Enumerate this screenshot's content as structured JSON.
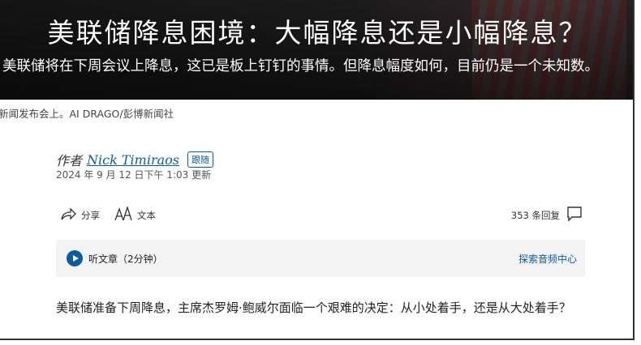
{
  "hero": {
    "title": "美联储降息困境：大幅降息还是小幅降息？",
    "subtitle": "美联储将在下周会议上降息，这已是板上钉钉的事情。但降息幅度如何，目前仍是一个未知数。"
  },
  "caption": "新闻发布会上。AI DRAGO/彭博新闻社",
  "byline": {
    "prefix": "作者",
    "author": "Nick Timiraos",
    "follow_label": "跟随",
    "date": "2024 年 9 月 12 日下午 1:03 更新"
  },
  "tools": {
    "share_label": "分享",
    "text_label": "文本",
    "comments_label": "353 条回复"
  },
  "audio": {
    "listen_label": "听文章（2分钟）",
    "explore_label": "探索音频中心"
  },
  "body": {
    "paragraph": "美联储准备下周降息，主席杰罗姆·鲍威尔面临一个艰难的决定：从小处着手，还是从大处着手？"
  },
  "colors": {
    "link": "#0b5c9e",
    "audio_bg": "#f3f3f3"
  },
  "icons": [
    "share-icon",
    "text-size-icon",
    "comment-icon",
    "play-icon"
  ]
}
